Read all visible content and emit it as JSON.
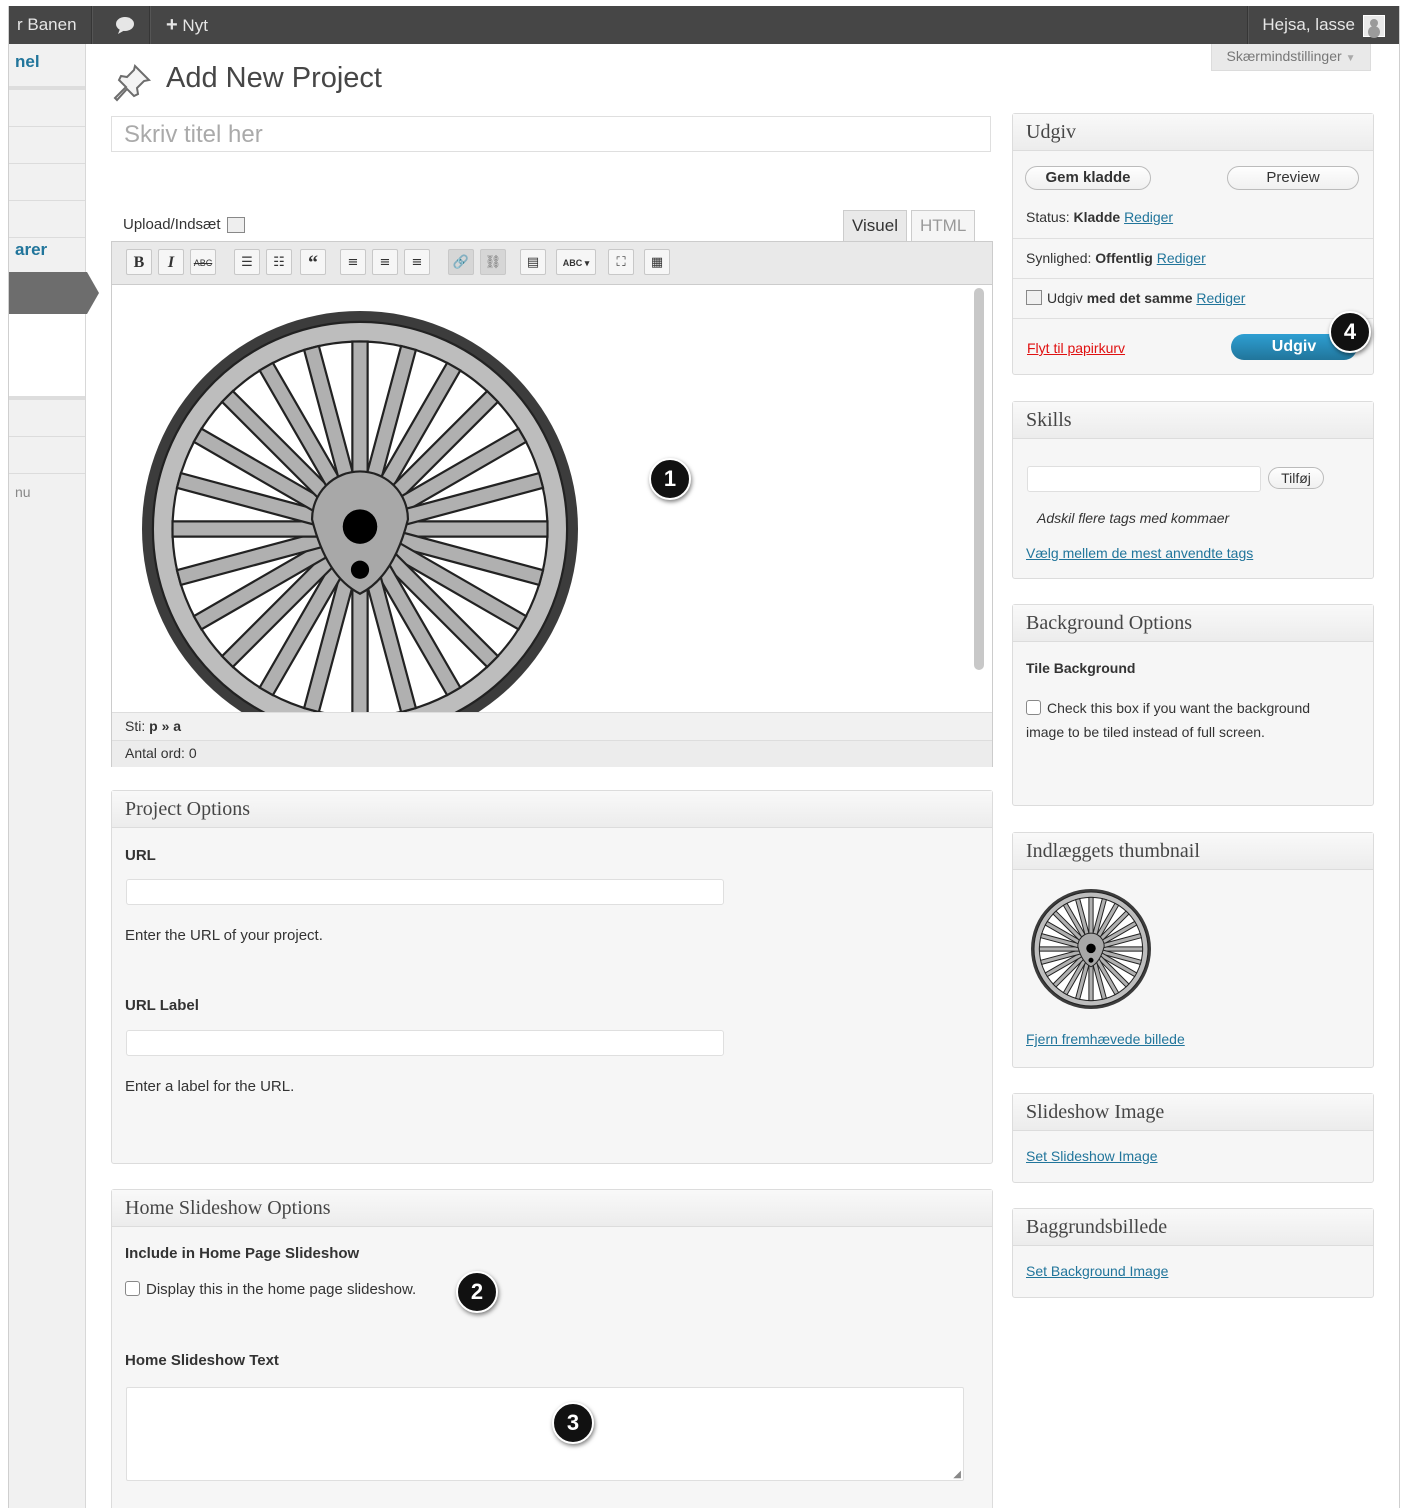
{
  "topbar": {
    "site_name": "r Banen",
    "new_label": "Nyt",
    "howdy": "Hejsa, lasse"
  },
  "sidebar": {
    "item1": "nel",
    "item2": "arer",
    "item3": "nu"
  },
  "screen_options": "Skærmindstillinger",
  "page_title": "Add New Project",
  "title_placeholder": "Skriv titel her",
  "editor": {
    "upload_label": "Upload/Indsæt",
    "tab_visual": "Visuel",
    "tab_html": "HTML",
    "toolbar": [
      "B",
      "I",
      "ABC",
      "ul",
      "ol",
      "66",
      "align-left",
      "align-center",
      "align-right",
      "link",
      "unlink",
      "more",
      "spellcheck",
      "fullscreen",
      "kitchen-sink"
    ],
    "path_label": "Sti:",
    "path_value": "p » a",
    "word_count": "Antal ord: 0"
  },
  "project_options": {
    "title": "Project Options",
    "url_label": "URL",
    "url_help": "Enter the URL of your project.",
    "url_label_label": "URL Label",
    "url_label_help": "Enter a label for the URL."
  },
  "home_slideshow": {
    "title": "Home Slideshow Options",
    "include_label": "Include in Home Page Slideshow",
    "display_check": "Display this in the home page slideshow.",
    "text_label": "Home Slideshow Text"
  },
  "publish": {
    "title": "Udgiv",
    "save_draft": "Gem kladde",
    "preview": "Preview",
    "status_label": "Status:",
    "status_value": "Kladde",
    "edit": "Rediger",
    "visibility_label": "Synlighed:",
    "visibility_value": "Offentlig",
    "publish_prefix": "Udgiv",
    "publish_when": "med det samme",
    "trash": "Flyt til papirkurv",
    "publish_button": "Udgiv"
  },
  "skills": {
    "title": "Skills",
    "add_button": "Tilføj",
    "hint": "Adskil flere tags med kommaer",
    "choose_link": "Vælg mellem de mest anvendte tags"
  },
  "background_options": {
    "title": "Background Options",
    "tile_label": "Tile Background",
    "tile_check_line1": "Check this box if you want the background",
    "tile_check_line2": "image to be tiled instead of full screen."
  },
  "thumbnail": {
    "title": "Indlæggets thumbnail",
    "remove_link": "Fjern fremhævede billede"
  },
  "slideshow_image": {
    "title": "Slideshow Image",
    "set_link": "Set Slideshow Image"
  },
  "background_image": {
    "title": "Baggrundsbillede",
    "set_link": "Set Background Image"
  },
  "callouts": [
    "1",
    "2",
    "3",
    "4"
  ],
  "colors": {
    "admin_bar": "#464646",
    "link": "#21759b",
    "publish_button": "#21759b",
    "trash": "#e01010",
    "callout": "#111111"
  }
}
